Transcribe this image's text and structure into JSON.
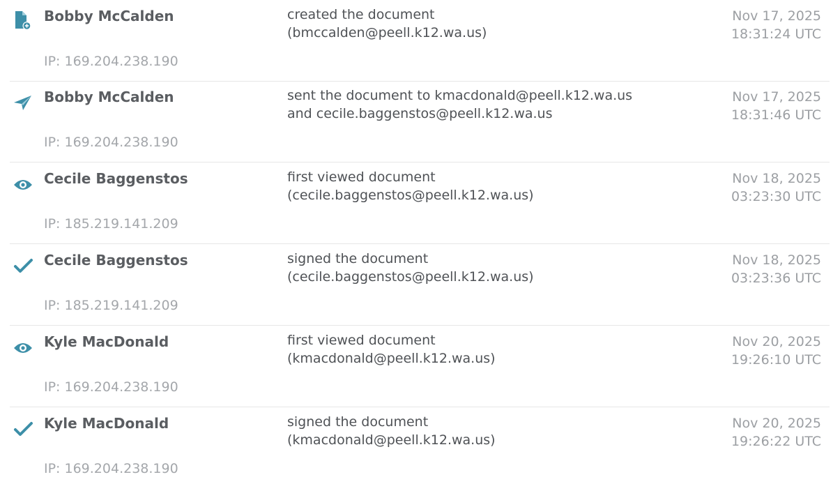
{
  "colors": {
    "accent": "#3d8fa8",
    "name_text": "#5a5d61",
    "muted_text": "#a4a7ab",
    "divider": "#e6e6e6"
  },
  "events": [
    {
      "icon": "document-plus-icon",
      "name": "Bobby McCalden",
      "action_line1": "created the document",
      "action_line2": "(bmccalden@peell.k12.wa.us)",
      "date": "Nov 17, 2025",
      "time": "18:31:24 UTC",
      "ip": "IP: 169.204.238.190"
    },
    {
      "icon": "paper-plane-icon",
      "name": "Bobby McCalden",
      "action_line1": "sent the document to kmacdonald@peell.k12.wa.us",
      "action_line2": "and cecile.baggenstos@peell.k12.wa.us",
      "date": "Nov 17, 2025",
      "time": "18:31:46 UTC",
      "ip": "IP: 169.204.238.190"
    },
    {
      "icon": "eye-icon",
      "name": "Cecile Baggenstos",
      "action_line1": "first viewed document",
      "action_line2": "(cecile.baggenstos@peell.k12.wa.us)",
      "date": "Nov 18, 2025",
      "time": "03:23:30 UTC",
      "ip": "IP: 185.219.141.209"
    },
    {
      "icon": "checkmark-icon",
      "name": "Cecile Baggenstos",
      "action_line1": "signed the document",
      "action_line2": "(cecile.baggenstos@peell.k12.wa.us)",
      "date": "Nov 18, 2025",
      "time": "03:23:36 UTC",
      "ip": "IP: 185.219.141.209"
    },
    {
      "icon": "eye-icon",
      "name": "Kyle MacDonald",
      "action_line1": "first viewed document",
      "action_line2": "(kmacdonald@peell.k12.wa.us)",
      "date": "Nov 20, 2025",
      "time": "19:26:10 UTC",
      "ip": "IP: 169.204.238.190"
    },
    {
      "icon": "checkmark-icon",
      "name": "Kyle MacDonald",
      "action_line1": "signed the document",
      "action_line2": "(kmacdonald@peell.k12.wa.us)",
      "date": "Nov 20, 2025",
      "time": "19:26:22 UTC",
      "ip": "IP: 169.204.238.190"
    }
  ]
}
